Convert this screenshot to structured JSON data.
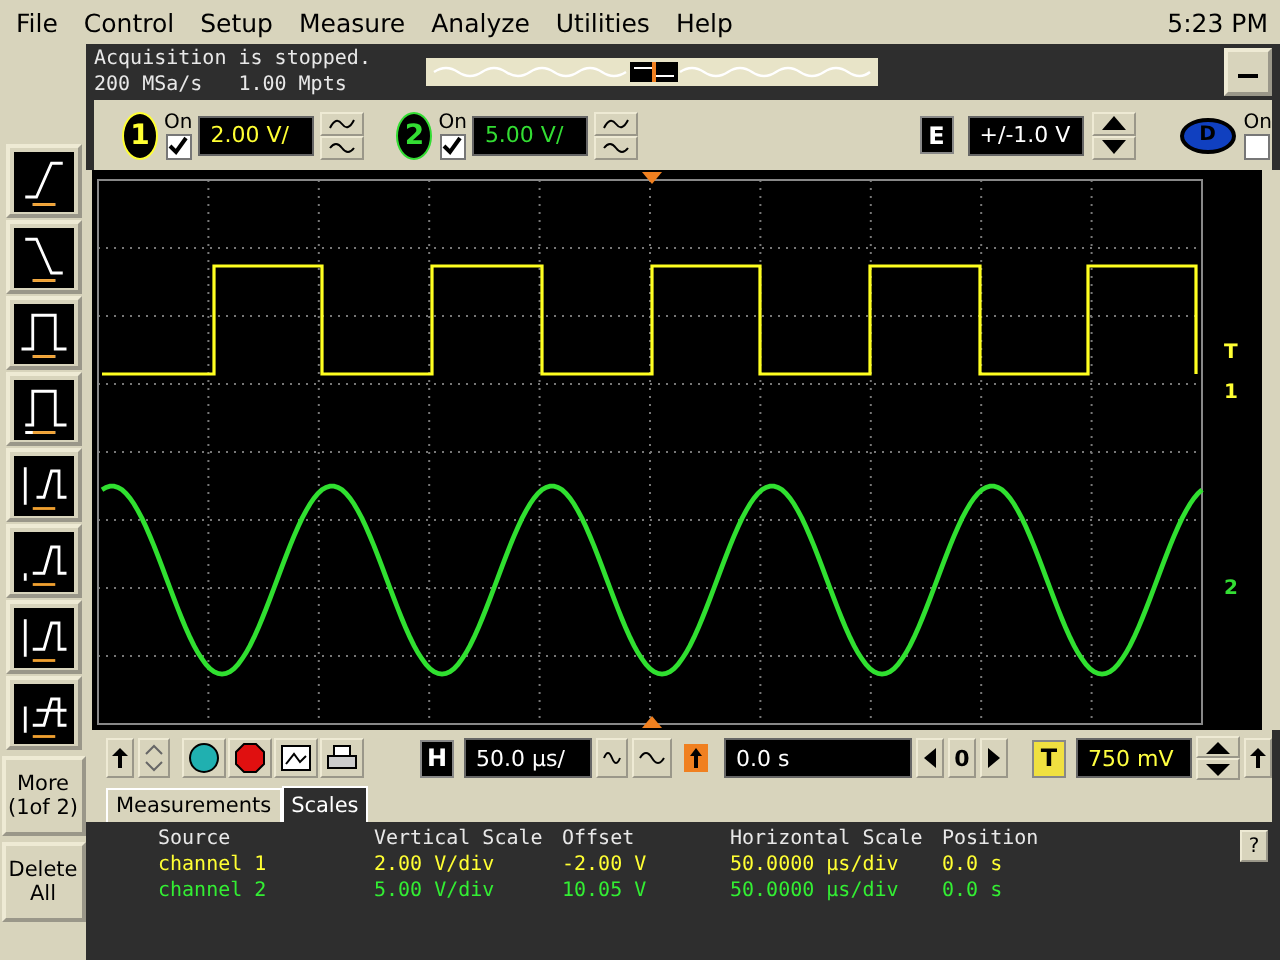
{
  "menu": [
    "File",
    "Control",
    "Setup",
    "Measure",
    "Analyze",
    "Utilities",
    "Help"
  ],
  "clock": "5:23 PM",
  "status": {
    "message": "Acquisition is stopped.",
    "rate": "200 MSa/s",
    "memory": "1.00 Mpts"
  },
  "channels": [
    {
      "number": "1",
      "on_label": "On",
      "on": true,
      "scale": "2.00 V/",
      "color": "#ffff33"
    },
    {
      "number": "2",
      "on_label": "On",
      "on": true,
      "scale": "5.00 V/",
      "color": "#33dd33"
    }
  ],
  "external": {
    "label": "E",
    "range": "+/-1.0 V"
  },
  "digital": {
    "label": "D",
    "on_label": "On",
    "on": false
  },
  "markers": [
    {
      "label": "T",
      "color": "#ffff33"
    },
    {
      "label": "1",
      "color": "#ffff33"
    },
    {
      "label": "2",
      "color": "#33dd33"
    }
  ],
  "trigger_tools": [
    {
      "kind": "rise"
    },
    {
      "kind": "fall"
    },
    {
      "kind": "pulse"
    },
    {
      "kind": "pulse-count"
    },
    {
      "kind": "runt"
    },
    {
      "kind": "runt-low"
    },
    {
      "kind": "runt-high"
    },
    {
      "kind": "runt-window"
    }
  ],
  "side_buttons": [
    "More\n(1of 2)",
    "Delete\nAll"
  ],
  "horizontal": {
    "label": "H",
    "scale": "50.0 µs/",
    "delay": "0.0 s",
    "reference": "0"
  },
  "trigger": {
    "label": "T",
    "level": "750 mV"
  },
  "tabs": [
    {
      "label": "Measurements",
      "selected": false
    },
    {
      "label": "Scales",
      "selected": true
    }
  ],
  "table": {
    "columns": [
      "Source",
      "Vertical Scale",
      "Offset",
      "Horizontal Scale",
      "Position"
    ],
    "rows": [
      {
        "color": "#ffff33",
        "cells": [
          "channel 1",
          "2.00 V/div",
          "-2.00 V",
          "50.0000 µs/div",
          "0.0 s"
        ]
      },
      {
        "color": "#33ee33",
        "cells": [
          "channel 2",
          "5.00 V/div",
          "10.05 V",
          "50.0000 µs/div",
          "0.0 s"
        ]
      }
    ]
  },
  "help": "?"
}
